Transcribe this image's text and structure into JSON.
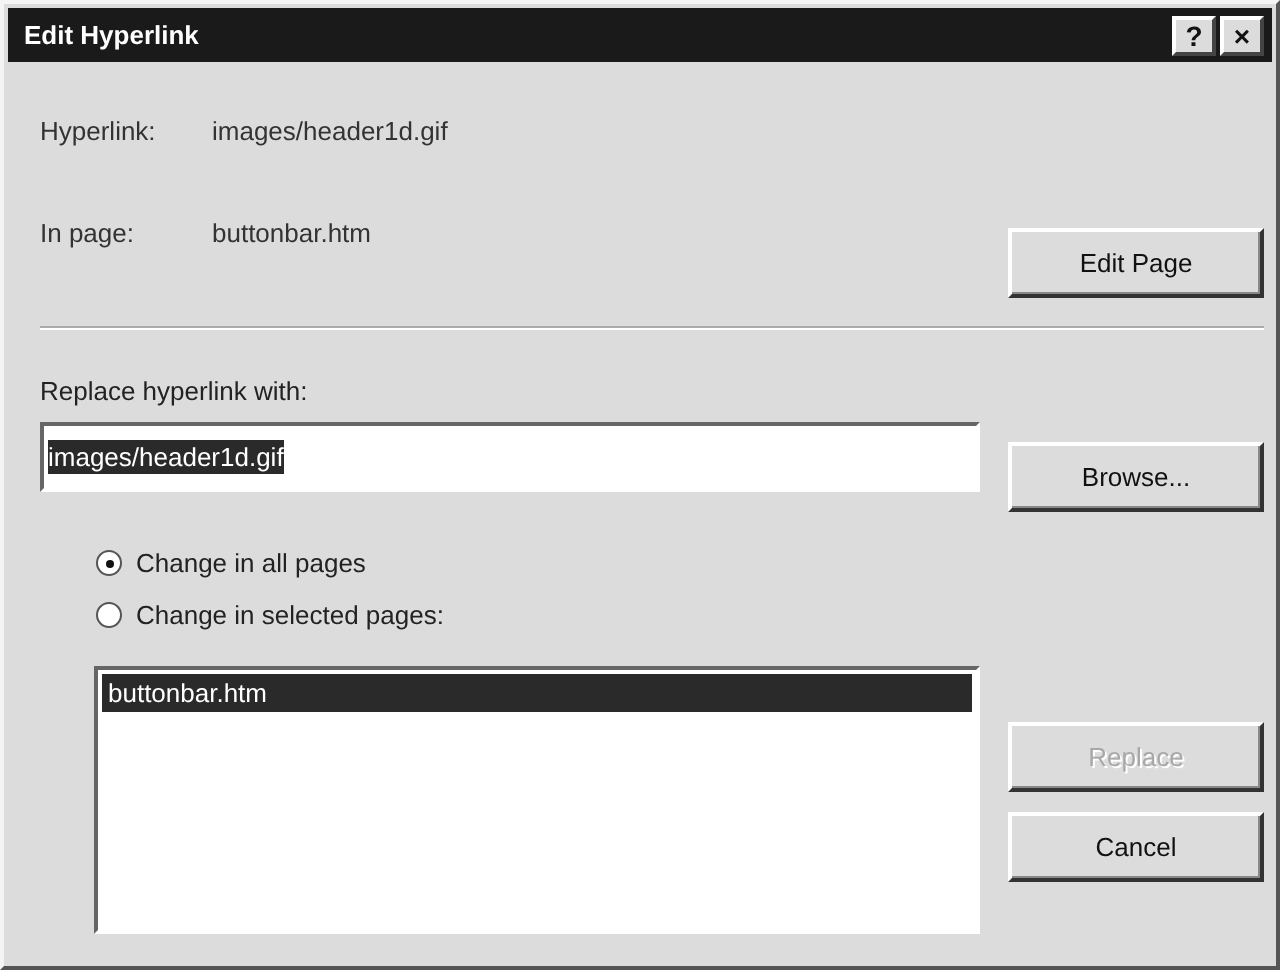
{
  "window": {
    "title": "Edit Hyperlink",
    "title_buttons": [
      "?",
      "×"
    ]
  },
  "hyperlink": {
    "label": "Hyperlink:",
    "value": "images/header1d.gif"
  },
  "in_page": {
    "label": "In page:",
    "value": "buttonbar.htm"
  },
  "edit_page_button": {
    "label": "Edit Page",
    "disabled": false
  },
  "replace_with": {
    "label": "Replace hyperlink with:",
    "value": "images/header1d.gif",
    "value_selected": true
  },
  "browse_button": {
    "label": "Browse...",
    "disabled": false
  },
  "scope_options": [
    {
      "label": "Change in all pages",
      "selected": true
    },
    {
      "label": "Change in selected pages:",
      "selected": false
    }
  ],
  "pages": [
    {
      "label": "buttonbar.htm",
      "selected": true
    }
  ],
  "replace_button": {
    "label": "Replace",
    "disabled": true
  },
  "cancel_button": {
    "label": "Cancel",
    "disabled": false
  }
}
